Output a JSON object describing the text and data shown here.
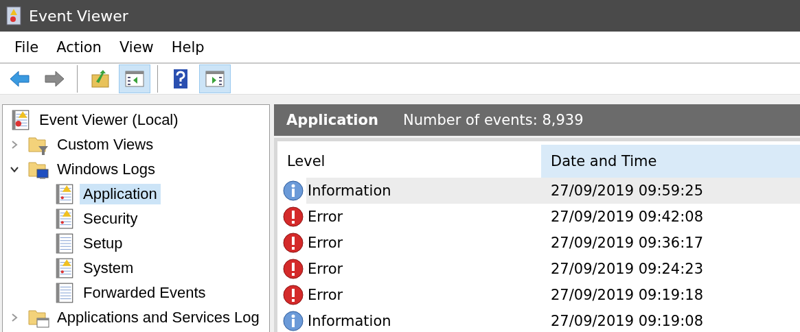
{
  "window": {
    "title": "Event Viewer"
  },
  "menu": [
    "File",
    "Action",
    "View",
    "Help"
  ],
  "toolbar": [
    {
      "kind": "back",
      "disabled": false,
      "pressed": false
    },
    {
      "kind": "forward",
      "disabled": true,
      "pressed": false
    },
    {
      "kind": "separator"
    },
    {
      "kind": "up",
      "pressed": false
    },
    {
      "kind": "tree-toggle",
      "pressed": true
    },
    {
      "kind": "separator"
    },
    {
      "kind": "help",
      "pressed": false
    },
    {
      "kind": "action-toggle",
      "pressed": true
    }
  ],
  "tree": [
    {
      "label": "Event Viewer (Local)",
      "kind": "root",
      "selected": false,
      "children": [
        {
          "label": "Custom Views",
          "kind": "folder-filter",
          "expanded": false,
          "selected": false
        },
        {
          "label": "Windows Logs",
          "kind": "folder-computer",
          "expanded": true,
          "selected": false,
          "children": [
            {
              "label": "Application",
              "kind": "log-warning",
              "selected": true
            },
            {
              "label": "Security",
              "kind": "log-warning",
              "selected": false
            },
            {
              "label": "Setup",
              "kind": "log",
              "selected": false
            },
            {
              "label": "System",
              "kind": "log-warning",
              "selected": false
            },
            {
              "label": "Forwarded Events",
              "kind": "log",
              "selected": false
            }
          ]
        },
        {
          "label": "Applications and Services Log",
          "kind": "folder-window",
          "expanded": false,
          "selected": false
        }
      ]
    }
  ],
  "pane": {
    "title": "Application",
    "summary": "Number of events: 8,939"
  },
  "table": {
    "columns": [
      {
        "label": "Level",
        "selected": false
      },
      {
        "label": "Date and Time",
        "selected": true
      }
    ],
    "rows": [
      {
        "kind": "information",
        "text": "Information",
        "date": "27/09/2019 09:59:25",
        "selected": true
      },
      {
        "kind": "error",
        "text": "Error",
        "date": "27/09/2019 09:42:08",
        "selected": false
      },
      {
        "kind": "error",
        "text": "Error",
        "date": "27/09/2019 09:36:17",
        "selected": false
      },
      {
        "kind": "error",
        "text": "Error",
        "date": "27/09/2019 09:24:23",
        "selected": false
      },
      {
        "kind": "error",
        "text": "Error",
        "date": "27/09/2019 09:19:18",
        "selected": false
      },
      {
        "kind": "information",
        "text": "Information",
        "date": "27/09/2019 09:19:08",
        "selected": false
      }
    ]
  }
}
